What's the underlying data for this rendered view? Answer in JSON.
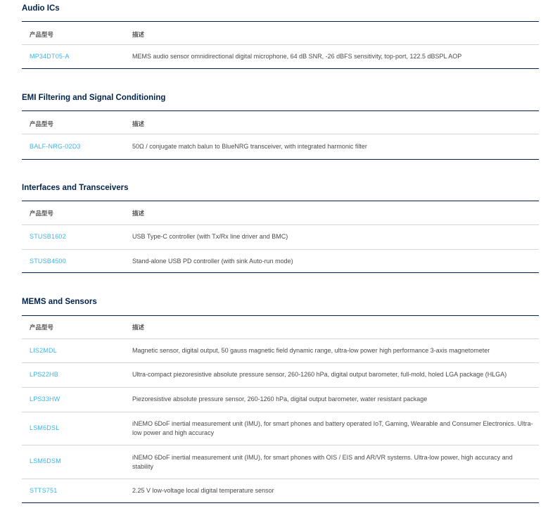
{
  "header": {
    "col_part": "产品型号",
    "col_desc": "描述"
  },
  "sections": [
    {
      "title": "Audio ICs",
      "rows": [
        {
          "part": "MP34DT05-A",
          "desc": "MEMS audio sensor omnidirectional digital microphone, 64 dB SNR, -26 dBFS sensitivity, top-port, 122.5 dBSPL AOP"
        }
      ]
    },
    {
      "title": "EMI Filtering and Signal Conditioning",
      "rows": [
        {
          "part": "BALF-NRG-02D3",
          "desc": "50Ω / conjugate match balun to BlueNRG transceiver, with integrated harmonic filter"
        }
      ]
    },
    {
      "title": "Interfaces and Transceivers",
      "rows": [
        {
          "part": "STUSB1602",
          "desc": "USB Type-C controller (with Tx/Rx line driver and BMC)"
        },
        {
          "part": "STUSB4500",
          "desc": "Stand-alone USB PD controller (with sink Auto-run mode)"
        }
      ]
    },
    {
      "title": "MEMS and Sensors",
      "rows": [
        {
          "part": "LIS2MDL",
          "desc": "Magnetic sensor, digital output, 50 gauss magnetic field dynamic range, ultra-low power high performance 3-axis magnetometer"
        },
        {
          "part": "LPS22HB",
          "desc": "Ultra-compact piezoresistive absolute pressure sensor, 260-1260 hPa, digital output barometer, full-mold, holed LGA package (HLGA)"
        },
        {
          "part": "LPS33HW",
          "desc": "Piezoresistive absolute pressure sensor, 260-1260 hPa, digital output barometer, water resistant package"
        },
        {
          "part": "LSM6DSL",
          "desc": "iNEMO 6DoF inertial measurement unit (IMU), for smart phones and battery operated IoT, Gaming, Wearable and Consumer Electronics. Ultra-low power and high accuracy"
        },
        {
          "part": "LSM6DSM",
          "desc": "iNEMO 6DoF inertial measurement unit (IMU), for smart phones with OIS / EIS and AR/VR systems. Ultra-low power, high accuracy and stability"
        },
        {
          "part": "STTS751",
          "desc": "2.25 V low-voltage local digital temperature sensor"
        }
      ]
    }
  ]
}
